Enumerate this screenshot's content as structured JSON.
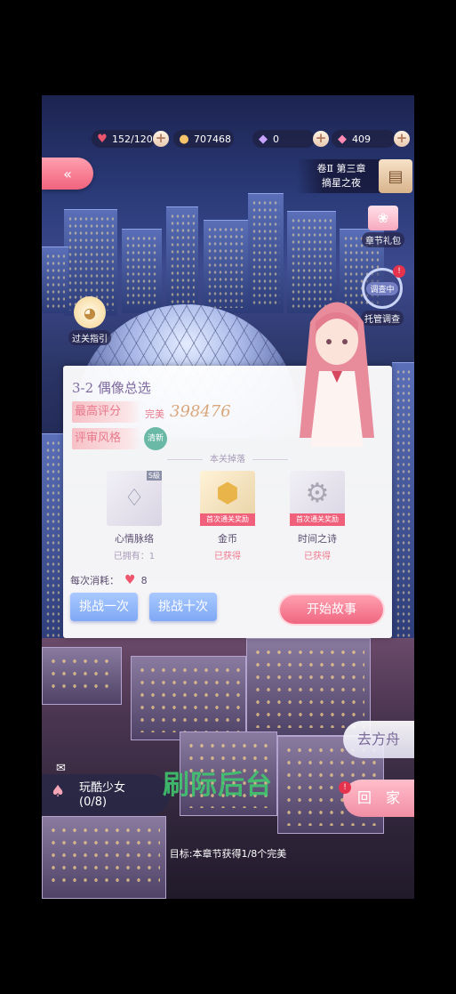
{
  "resources": {
    "stamina": "152/120",
    "coins": "707468",
    "diamonds": "0",
    "gems": "409"
  },
  "chapter": {
    "volume": "卷Ⅱ 第三章",
    "name": "摘星之夜"
  },
  "side": {
    "gift": "章节礼包",
    "investigating": "调查中",
    "auto_investigate": "托管调查",
    "guide": "过关指引"
  },
  "stage": {
    "title": "3-2 偶像总选",
    "best_label": "最高评分",
    "score_label": "完美",
    "score": "398476",
    "style_label": "评审风格",
    "style_value": "清新",
    "drops_title": "本关掉落",
    "drops": [
      {
        "name": "心情脉络",
        "status": "已拥有：1",
        "badge": "",
        "corner": "S級"
      },
      {
        "name": "金币",
        "status": "已获得",
        "badge": "首次通关奖励",
        "corner": ""
      },
      {
        "name": "时间之诗",
        "status": "已获得",
        "badge": "首次通关奖励",
        "corner": ""
      }
    ],
    "cost_label": "每次消耗：",
    "cost_value": "8",
    "challenge_once": "挑战一次",
    "challenge_ten": "挑战十次",
    "start": "开始故事"
  },
  "right_buttons": {
    "ark": "去方舟",
    "home": "回　家"
  },
  "quest": {
    "title": "玩酷少女",
    "progress": "(0/8)"
  },
  "goal": "目标:本章节获得1/8个完美",
  "watermark": "刷际后台",
  "colors": {
    "accent_pink": "#f0637d",
    "accent_blue": "#7fa8f5",
    "score_gold": "#d9a77c"
  }
}
